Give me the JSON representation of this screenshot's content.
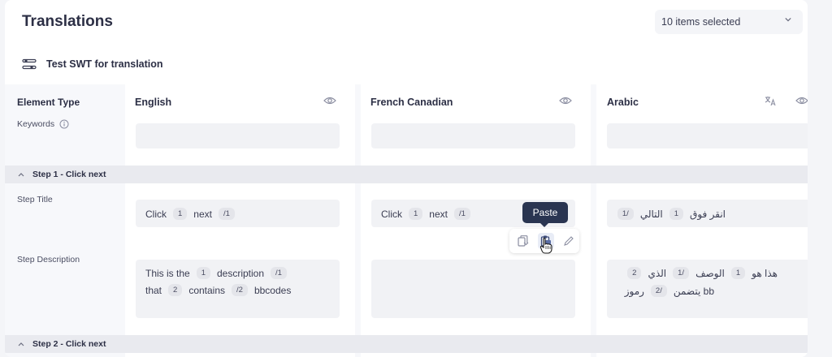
{
  "header": {
    "title": "Translations",
    "selector_label": "10 items selected"
  },
  "project": {
    "name": "Test SWT for translation"
  },
  "columns": {
    "element_type": "Element Type",
    "keywords": "Keywords",
    "languages": [
      "English",
      "French Canadian",
      "Arabic"
    ]
  },
  "sections": [
    {
      "label": "Step 1 - Click next"
    },
    {
      "label": "Step 2 - Click next"
    }
  ],
  "rows": {
    "step_title": "Step Title",
    "step_description": "Step Description"
  },
  "cells": {
    "title_en": {
      "w1": "Click",
      "t1": "1",
      "w2": "next",
      "t2": "/1"
    },
    "title_fr": {
      "w1": "Click",
      "t1": "1",
      "w2": "next",
      "t2": "/1"
    },
    "title_ar": {
      "w1": "انقر فوق",
      "t1": "1",
      "w2": "التالي",
      "t2": "/1"
    },
    "desc_en": {
      "line1": {
        "w1": "This is the",
        "t1": "1",
        "w2": "description",
        "t2": "/1"
      },
      "line2": {
        "w1": "that",
        "t1": "2",
        "w2": "contains",
        "t2": "/2",
        "w3": "bbcodes"
      }
    },
    "desc_ar": {
      "line1": {
        "w1": "هذا هو",
        "t1": "1",
        "w2": "الوصف",
        "t2": "/1",
        "w3": "الذي",
        "t3": "2"
      },
      "line2": {
        "w1": "bb يتضمن",
        "t1": "/2",
        "w2": "رموز"
      }
    }
  },
  "tooltip": {
    "label": "Paste"
  },
  "icons": {
    "selector": "chevron-down-icon",
    "project": "sliders-icon",
    "keywords_info": "info-icon",
    "visibility": "eye-icon",
    "auto_translate": "translate-icon",
    "section_toggle": "chevron-up-icon",
    "copy": "copy-icon",
    "paste": "paste-icon",
    "edit": "pencil-icon",
    "cursor": "hand-pointer-icon"
  },
  "colors": {
    "tooltip_bg": "#2a3551",
    "section_bg": "#e9eaef",
    "cell_bg": "#f1f2f5"
  }
}
